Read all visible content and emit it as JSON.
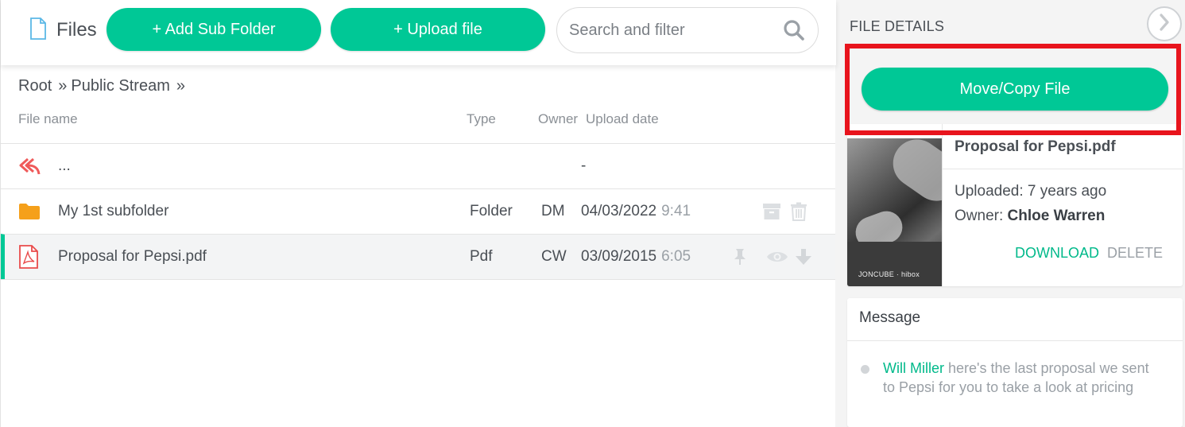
{
  "topbar": {
    "title": "Files",
    "add_sub_folder_label": "+ Add Sub Folder",
    "upload_file_label": "+ Upload file",
    "search_placeholder": "Search and filter"
  },
  "breadcrumb": {
    "items": [
      "Root",
      "Public Stream"
    ],
    "separator": "»"
  },
  "table": {
    "headers": {
      "file_name": "File name",
      "type": "Type",
      "owner": "Owner",
      "upload_date": "Upload date"
    },
    "rows": [
      {
        "name": "...",
        "type": "",
        "owner": "",
        "date": "-",
        "time": ""
      },
      {
        "name": "My 1st subfolder",
        "type": "Folder",
        "owner": "DM",
        "date": "04/03/2022",
        "time": "9:41"
      },
      {
        "name": "Proposal for Pepsi.pdf",
        "type": "Pdf",
        "owner": "CW",
        "date": "03/09/2015",
        "time": "6:05"
      }
    ]
  },
  "sidebar": {
    "title": "FILE DETAILS",
    "move_copy_label": "Move/Copy File",
    "file": {
      "name": "Proposal for Pepsi.pdf",
      "uploaded_label": "Uploaded:",
      "uploaded_value": "7 years ago",
      "owner_label": "Owner:",
      "owner_value": "Chloe Warren",
      "thumbnail_brand": "JONCUBE · hibox",
      "download_label": "DOWNLOAD",
      "delete_label": "DELETE"
    },
    "message": {
      "title": "Message",
      "author": "Will Miller",
      "text": "here's the last proposal we sent to Pepsi for you to take a look at pricing"
    }
  },
  "colors": {
    "accent": "#00c896",
    "highlight_border": "#e8141d",
    "folder": "#f5a01a",
    "pdf": "#e94b4b",
    "back_arrow": "#ef5a5a"
  }
}
